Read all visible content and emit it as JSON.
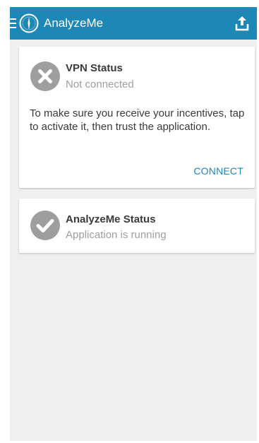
{
  "app_bar": {
    "title": "AnalyzeMe",
    "menu_icon": "hamburger-menu-icon",
    "logo_icon": "analyzeme-logo-icon",
    "share_icon": "share-upload-icon",
    "background_color": "#1d87b8"
  },
  "vpn_card": {
    "icon": "close-circle-icon",
    "title": "VPN Status",
    "status": "Not connected",
    "message": "To make sure you receive your incentives, tap to activate it, then trust the application.",
    "action_label": "CONNECT",
    "action_color": "#1d87b8"
  },
  "app_card": {
    "icon": "check-circle-icon",
    "title": "AnalyzeMe Status",
    "status": "Application is running"
  }
}
